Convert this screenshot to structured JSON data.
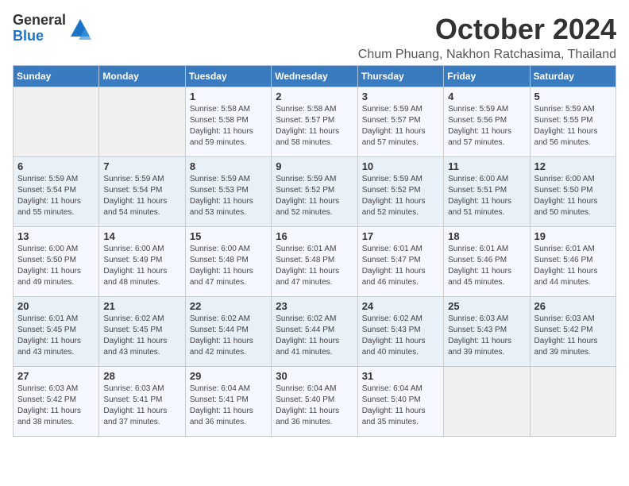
{
  "logo": {
    "general": "General",
    "blue": "Blue"
  },
  "title": {
    "month": "October 2024",
    "location": "Chum Phuang, Nakhon Ratchasima, Thailand"
  },
  "weekdays": [
    "Sunday",
    "Monday",
    "Tuesday",
    "Wednesday",
    "Thursday",
    "Friday",
    "Saturday"
  ],
  "weeks": [
    [
      {
        "day": "",
        "sunrise": "",
        "sunset": "",
        "daylight": ""
      },
      {
        "day": "",
        "sunrise": "",
        "sunset": "",
        "daylight": ""
      },
      {
        "day": "1",
        "sunrise": "Sunrise: 5:58 AM",
        "sunset": "Sunset: 5:58 PM",
        "daylight": "Daylight: 11 hours and 59 minutes."
      },
      {
        "day": "2",
        "sunrise": "Sunrise: 5:58 AM",
        "sunset": "Sunset: 5:57 PM",
        "daylight": "Daylight: 11 hours and 58 minutes."
      },
      {
        "day": "3",
        "sunrise": "Sunrise: 5:59 AM",
        "sunset": "Sunset: 5:57 PM",
        "daylight": "Daylight: 11 hours and 57 minutes."
      },
      {
        "day": "4",
        "sunrise": "Sunrise: 5:59 AM",
        "sunset": "Sunset: 5:56 PM",
        "daylight": "Daylight: 11 hours and 57 minutes."
      },
      {
        "day": "5",
        "sunrise": "Sunrise: 5:59 AM",
        "sunset": "Sunset: 5:55 PM",
        "daylight": "Daylight: 11 hours and 56 minutes."
      }
    ],
    [
      {
        "day": "6",
        "sunrise": "Sunrise: 5:59 AM",
        "sunset": "Sunset: 5:54 PM",
        "daylight": "Daylight: 11 hours and 55 minutes."
      },
      {
        "day": "7",
        "sunrise": "Sunrise: 5:59 AM",
        "sunset": "Sunset: 5:54 PM",
        "daylight": "Daylight: 11 hours and 54 minutes."
      },
      {
        "day": "8",
        "sunrise": "Sunrise: 5:59 AM",
        "sunset": "Sunset: 5:53 PM",
        "daylight": "Daylight: 11 hours and 53 minutes."
      },
      {
        "day": "9",
        "sunrise": "Sunrise: 5:59 AM",
        "sunset": "Sunset: 5:52 PM",
        "daylight": "Daylight: 11 hours and 52 minutes."
      },
      {
        "day": "10",
        "sunrise": "Sunrise: 5:59 AM",
        "sunset": "Sunset: 5:52 PM",
        "daylight": "Daylight: 11 hours and 52 minutes."
      },
      {
        "day": "11",
        "sunrise": "Sunrise: 6:00 AM",
        "sunset": "Sunset: 5:51 PM",
        "daylight": "Daylight: 11 hours and 51 minutes."
      },
      {
        "day": "12",
        "sunrise": "Sunrise: 6:00 AM",
        "sunset": "Sunset: 5:50 PM",
        "daylight": "Daylight: 11 hours and 50 minutes."
      }
    ],
    [
      {
        "day": "13",
        "sunrise": "Sunrise: 6:00 AM",
        "sunset": "Sunset: 5:50 PM",
        "daylight": "Daylight: 11 hours and 49 minutes."
      },
      {
        "day": "14",
        "sunrise": "Sunrise: 6:00 AM",
        "sunset": "Sunset: 5:49 PM",
        "daylight": "Daylight: 11 hours and 48 minutes."
      },
      {
        "day": "15",
        "sunrise": "Sunrise: 6:00 AM",
        "sunset": "Sunset: 5:48 PM",
        "daylight": "Daylight: 11 hours and 47 minutes."
      },
      {
        "day": "16",
        "sunrise": "Sunrise: 6:01 AM",
        "sunset": "Sunset: 5:48 PM",
        "daylight": "Daylight: 11 hours and 47 minutes."
      },
      {
        "day": "17",
        "sunrise": "Sunrise: 6:01 AM",
        "sunset": "Sunset: 5:47 PM",
        "daylight": "Daylight: 11 hours and 46 minutes."
      },
      {
        "day": "18",
        "sunrise": "Sunrise: 6:01 AM",
        "sunset": "Sunset: 5:46 PM",
        "daylight": "Daylight: 11 hours and 45 minutes."
      },
      {
        "day": "19",
        "sunrise": "Sunrise: 6:01 AM",
        "sunset": "Sunset: 5:46 PM",
        "daylight": "Daylight: 11 hours and 44 minutes."
      }
    ],
    [
      {
        "day": "20",
        "sunrise": "Sunrise: 6:01 AM",
        "sunset": "Sunset: 5:45 PM",
        "daylight": "Daylight: 11 hours and 43 minutes."
      },
      {
        "day": "21",
        "sunrise": "Sunrise: 6:02 AM",
        "sunset": "Sunset: 5:45 PM",
        "daylight": "Daylight: 11 hours and 43 minutes."
      },
      {
        "day": "22",
        "sunrise": "Sunrise: 6:02 AM",
        "sunset": "Sunset: 5:44 PM",
        "daylight": "Daylight: 11 hours and 42 minutes."
      },
      {
        "day": "23",
        "sunrise": "Sunrise: 6:02 AM",
        "sunset": "Sunset: 5:44 PM",
        "daylight": "Daylight: 11 hours and 41 minutes."
      },
      {
        "day": "24",
        "sunrise": "Sunrise: 6:02 AM",
        "sunset": "Sunset: 5:43 PM",
        "daylight": "Daylight: 11 hours and 40 minutes."
      },
      {
        "day": "25",
        "sunrise": "Sunrise: 6:03 AM",
        "sunset": "Sunset: 5:43 PM",
        "daylight": "Daylight: 11 hours and 39 minutes."
      },
      {
        "day": "26",
        "sunrise": "Sunrise: 6:03 AM",
        "sunset": "Sunset: 5:42 PM",
        "daylight": "Daylight: 11 hours and 39 minutes."
      }
    ],
    [
      {
        "day": "27",
        "sunrise": "Sunrise: 6:03 AM",
        "sunset": "Sunset: 5:42 PM",
        "daylight": "Daylight: 11 hours and 38 minutes."
      },
      {
        "day": "28",
        "sunrise": "Sunrise: 6:03 AM",
        "sunset": "Sunset: 5:41 PM",
        "daylight": "Daylight: 11 hours and 37 minutes."
      },
      {
        "day": "29",
        "sunrise": "Sunrise: 6:04 AM",
        "sunset": "Sunset: 5:41 PM",
        "daylight": "Daylight: 11 hours and 36 minutes."
      },
      {
        "day": "30",
        "sunrise": "Sunrise: 6:04 AM",
        "sunset": "Sunset: 5:40 PM",
        "daylight": "Daylight: 11 hours and 36 minutes."
      },
      {
        "day": "31",
        "sunrise": "Sunrise: 6:04 AM",
        "sunset": "Sunset: 5:40 PM",
        "daylight": "Daylight: 11 hours and 35 minutes."
      },
      {
        "day": "",
        "sunrise": "",
        "sunset": "",
        "daylight": ""
      },
      {
        "day": "",
        "sunrise": "",
        "sunset": "",
        "daylight": ""
      }
    ]
  ]
}
